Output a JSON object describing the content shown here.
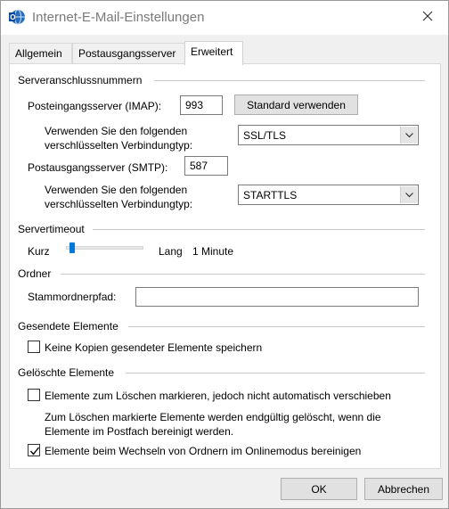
{
  "window": {
    "title": "Internet-E-Mail-Einstellungen",
    "app_icon": "outlook-globe-icon",
    "close_icon": "close-icon"
  },
  "tabs": [
    {
      "label": "Allgemein"
    },
    {
      "label": "Postausgangsserver"
    },
    {
      "label": "Erweitert"
    }
  ],
  "active_tab": "Erweitert",
  "server_ports": {
    "section_title": "Serveranschlussnummern",
    "imap_label": "Posteingangsserver (IMAP):",
    "imap_value": "993",
    "default_button": "Standard verwenden",
    "imap_enc_label_line1": "Verwenden Sie den folgenden",
    "imap_enc_label_line2": "verschlüsselten Verbindungtyp:",
    "imap_enc_value": "SSL/TLS",
    "smtp_label": "Postausgangsserver (SMTP):",
    "smtp_value": "587",
    "smtp_enc_label_line1": "Verwenden Sie den folgenden",
    "smtp_enc_label_line2": "verschlüsselten Verbindungtyp:",
    "smtp_enc_value": "STARTTLS"
  },
  "timeout": {
    "section_title": "Servertimeout",
    "short_label": "Kurz",
    "long_label": "Lang",
    "value_text": "1 Minute",
    "slider_fraction": 0.05
  },
  "folders": {
    "section_title": "Ordner",
    "root_path_label": "Stammordnerpfad:",
    "root_path_value": ""
  },
  "sent_items": {
    "section_title": "Gesendete Elemente",
    "no_copies_label": "Keine Kopien gesendeter Elemente speichern",
    "no_copies_checked": false
  },
  "deleted_items": {
    "section_title": "Gelöschte Elemente",
    "mark_for_deletion_label": "Elemente zum Löschen markieren, jedoch nicht automatisch verschieben",
    "mark_for_deletion_checked": false,
    "info_line1": "Zum Löschen markierte Elemente werden endgültig gelöscht, wenn die",
    "info_line2": "Elemente im Postfach bereinigt werden.",
    "purge_label": "Elemente beim Wechseln von Ordnern im Onlinemodus bereinigen",
    "purge_checked": true
  },
  "footer": {
    "ok_label": "OK",
    "cancel_label": "Abbrechen"
  },
  "colors": {
    "accent": "#0078d7"
  }
}
